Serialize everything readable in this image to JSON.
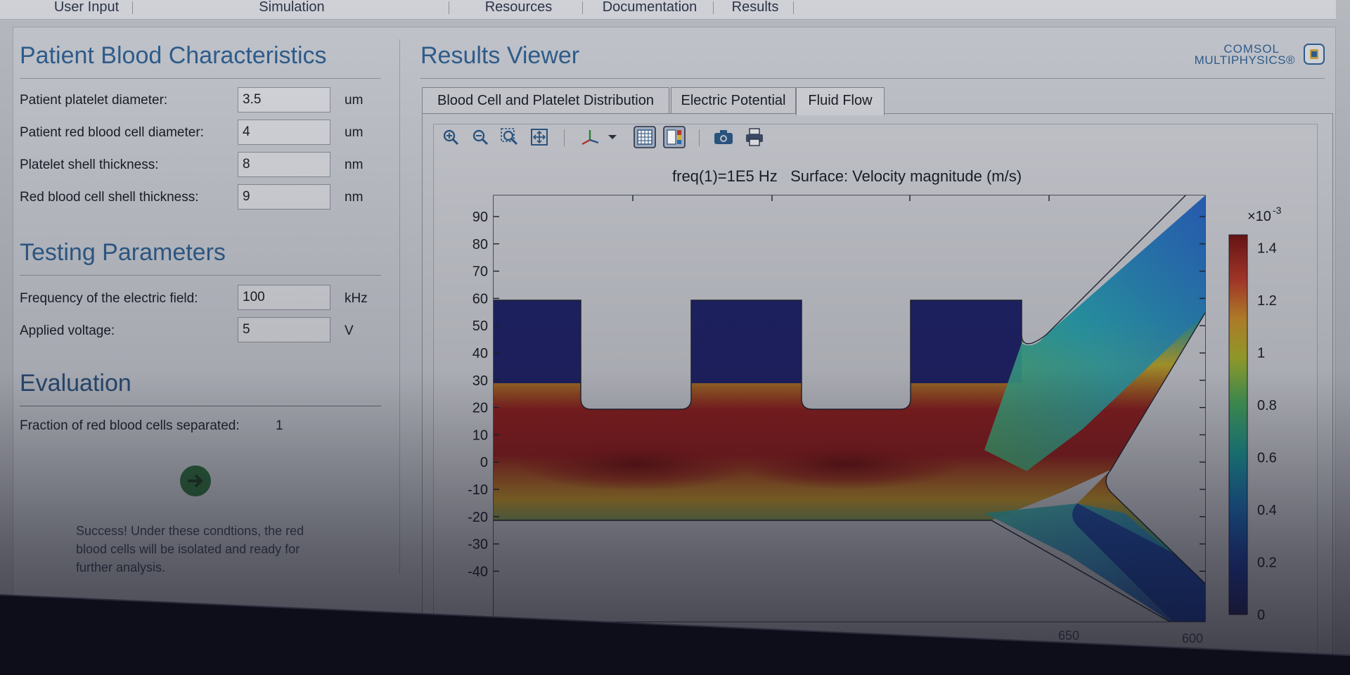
{
  "menubar": {
    "items": [
      "User Input",
      "Simulation",
      "Resources",
      "Documentation",
      "Results"
    ]
  },
  "left": {
    "blood_title": "Patient Blood Characteristics",
    "blood_fields": [
      {
        "label": "Patient platelet diameter:",
        "value": "3.5",
        "unit": "um"
      },
      {
        "label": "Patient red blood cell diameter:",
        "value": "4",
        "unit": "um"
      },
      {
        "label": "Platelet shell thickness:",
        "value": "8",
        "unit": "nm"
      },
      {
        "label": "Red blood cell shell thickness:",
        "value": "9",
        "unit": "nm"
      }
    ],
    "testing_title": "Testing Parameters",
    "testing_fields": [
      {
        "label": "Frequency of the electric field:",
        "value": "100",
        "unit": "kHz"
      },
      {
        "label": "Applied voltage:",
        "value": "5",
        "unit": "V"
      }
    ],
    "evaluation_title": "Evaluation",
    "evaluation_label": "Fraction of red blood cells separated:",
    "evaluation_value": "1",
    "success_message": "Success! Under these condtions, the red blood cells will be isolated and ready for further analysis."
  },
  "results": {
    "title": "Results Viewer",
    "logo_line1": "COMSOL",
    "logo_line2": "MULTIPHYSICS®",
    "tabs": [
      "Blood Cell and Platelet Distribution",
      "Electric Potential",
      "Fluid Flow"
    ],
    "active_tab": "Fluid Flow",
    "toolbar_icons": [
      "zoom-in-icon",
      "zoom-out-icon",
      "zoom-box-icon",
      "zoom-extents-icon",
      "axis-orientation-icon",
      "dropdown-arrow-icon",
      "grid-icon",
      "color-legend-icon",
      "camera-icon",
      "print-icon"
    ],
    "plot_title": "freq(1)=1E5 Hz   Surface: Velocity magnitude (m/s)"
  },
  "chart_data": {
    "type": "heatmap",
    "title": "freq(1)=1E5 Hz   Surface: Velocity magnitude (m/s)",
    "yticks": [
      "90",
      "80",
      "70",
      "60",
      "50",
      "40",
      "30",
      "20",
      "10",
      "0",
      "-10",
      "-20",
      "-30",
      "-40"
    ],
    "xticks_visible": [
      "650",
      "600"
    ],
    "colorbar_exponent": "×10",
    "colorbar_exponent_power": "-3",
    "colorbar_ticks": [
      "1.4",
      "1.2",
      "1",
      "0.8",
      "0.6",
      "0.4",
      "0.2",
      "0"
    ],
    "colorbar_range": [
      0,
      1.45
    ],
    "colormap": "rainbow",
    "colors": {
      "low": "#1a1f5e",
      "mid": "#3aa98f",
      "high": "#8a1a1a"
    }
  }
}
